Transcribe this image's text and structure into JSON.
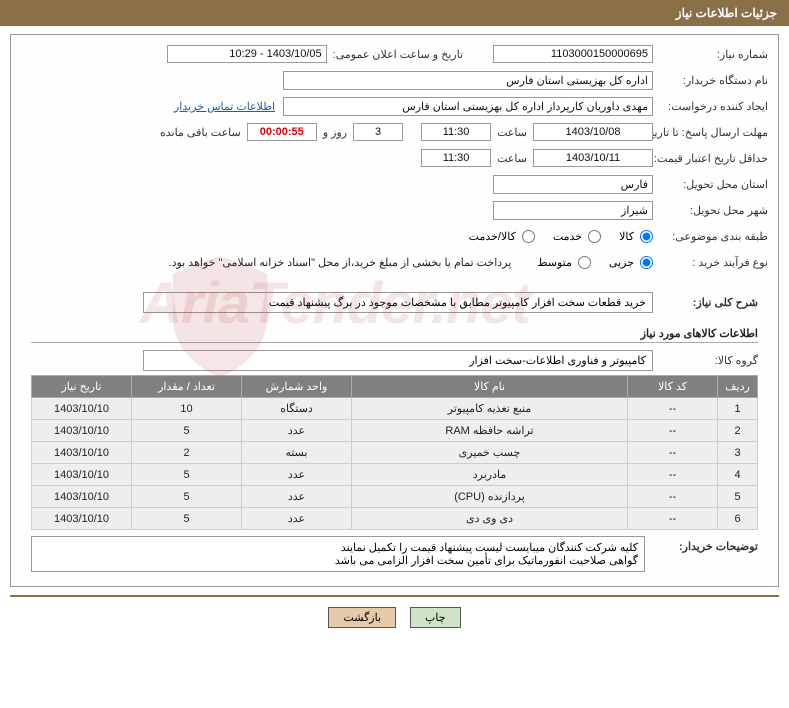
{
  "header": {
    "title": "جزئیات اطلاعات نیاز"
  },
  "fields": {
    "need_no_label": "شماره نیاز:",
    "need_no": "1103000150000695",
    "announce_dt_label": "تاریخ و ساعت اعلان عمومی:",
    "announce_dt": "1403/10/05 - 10:29",
    "buyer_org_label": "نام دستگاه خریدار:",
    "buyer_org": "اداره کل بهزیستی استان فارس",
    "requester_label": "ایجاد کننده درخواست:",
    "requester": "مهدی داوریان کارپرداز اداره کل بهزیستی استان فارس",
    "contact_link": "اطلاعات تماس خریدار",
    "deadline_label": "مهلت ارسال پاسخ: تا تاریخ:",
    "deadline_date": "1403/10/08",
    "time_word": "ساعت",
    "deadline_time": "11:30",
    "days_val": "3",
    "days_suffix": "روز و",
    "timer": "00:00:55",
    "remain_suffix": "ساعت باقی مانده",
    "validity_label": "حداقل تاریخ اعتبار قیمت: تا تاریخ:",
    "validity_date": "1403/10/11",
    "validity_time": "11:30",
    "province_label": "استان محل تحویل:",
    "province": "فارس",
    "city_label": "شهر محل تحویل:",
    "city": "شیراز",
    "class_label": "طبقه بندی موضوعی:",
    "radios1": {
      "a": "کالا",
      "b": "خدمت",
      "c": "کالا/خدمت"
    },
    "process_label": "نوع فرآیند خرید :",
    "radios2": {
      "a": "جزیی",
      "b": "متوسط"
    },
    "process_note": "پرداخت تمام یا بخشی از مبلغ خرید،از محل \"اسناد خزانه اسلامی\" خواهد بود."
  },
  "section1": {
    "title": "شرح کلی نیاز:",
    "desc": "خرید قطعات سخت افزار کامپیوتر مطابق با مشخصات موجود در برگ پیشنهاد قیمت"
  },
  "section2": {
    "title": "اطلاعات کالاهای مورد نیاز",
    "group_label": "گروه کالا:",
    "group_value": "کامپیوتر و فناوری اطلاعات-سخت افزار"
  },
  "table": {
    "headers": {
      "row": "ردیف",
      "code": "کد کالا",
      "name": "نام کالا",
      "unit": "واحد شمارش",
      "qty": "تعداد / مقدار",
      "date": "تاریخ نیاز"
    },
    "rows": [
      {
        "row": "1",
        "code": "--",
        "name": "منبع تغذیه کامپیوتر",
        "unit": "دستگاه",
        "qty": "10",
        "date": "1403/10/10"
      },
      {
        "row": "2",
        "code": "--",
        "name": "تراشه حافظه RAM",
        "unit": "عدد",
        "qty": "5",
        "date": "1403/10/10"
      },
      {
        "row": "3",
        "code": "--",
        "name": "چسب خمیری",
        "unit": "بسته",
        "qty": "2",
        "date": "1403/10/10"
      },
      {
        "row": "4",
        "code": "--",
        "name": "مادربرد",
        "unit": "عدد",
        "qty": "5",
        "date": "1403/10/10"
      },
      {
        "row": "5",
        "code": "--",
        "name": "پردازنده (CPU)",
        "unit": "عدد",
        "qty": "5",
        "date": "1403/10/10"
      },
      {
        "row": "6",
        "code": "--",
        "name": "دی وی دی",
        "unit": "عدد",
        "qty": "5",
        "date": "1403/10/10"
      }
    ]
  },
  "buyer_notes": {
    "label": "توضیحات خریدار:",
    "line1": "کلیه شرکت کنندگان میبایست لیست پیشنهاد قیمت را تکمیل نمایند",
    "line2": "گواهی صلاحیت انفورماتیک برای تأمین سخت افزار الزامی می باشد"
  },
  "buttons": {
    "back": "بازگشت",
    "print": "چاپ"
  },
  "watermark": "AriaTender.net"
}
